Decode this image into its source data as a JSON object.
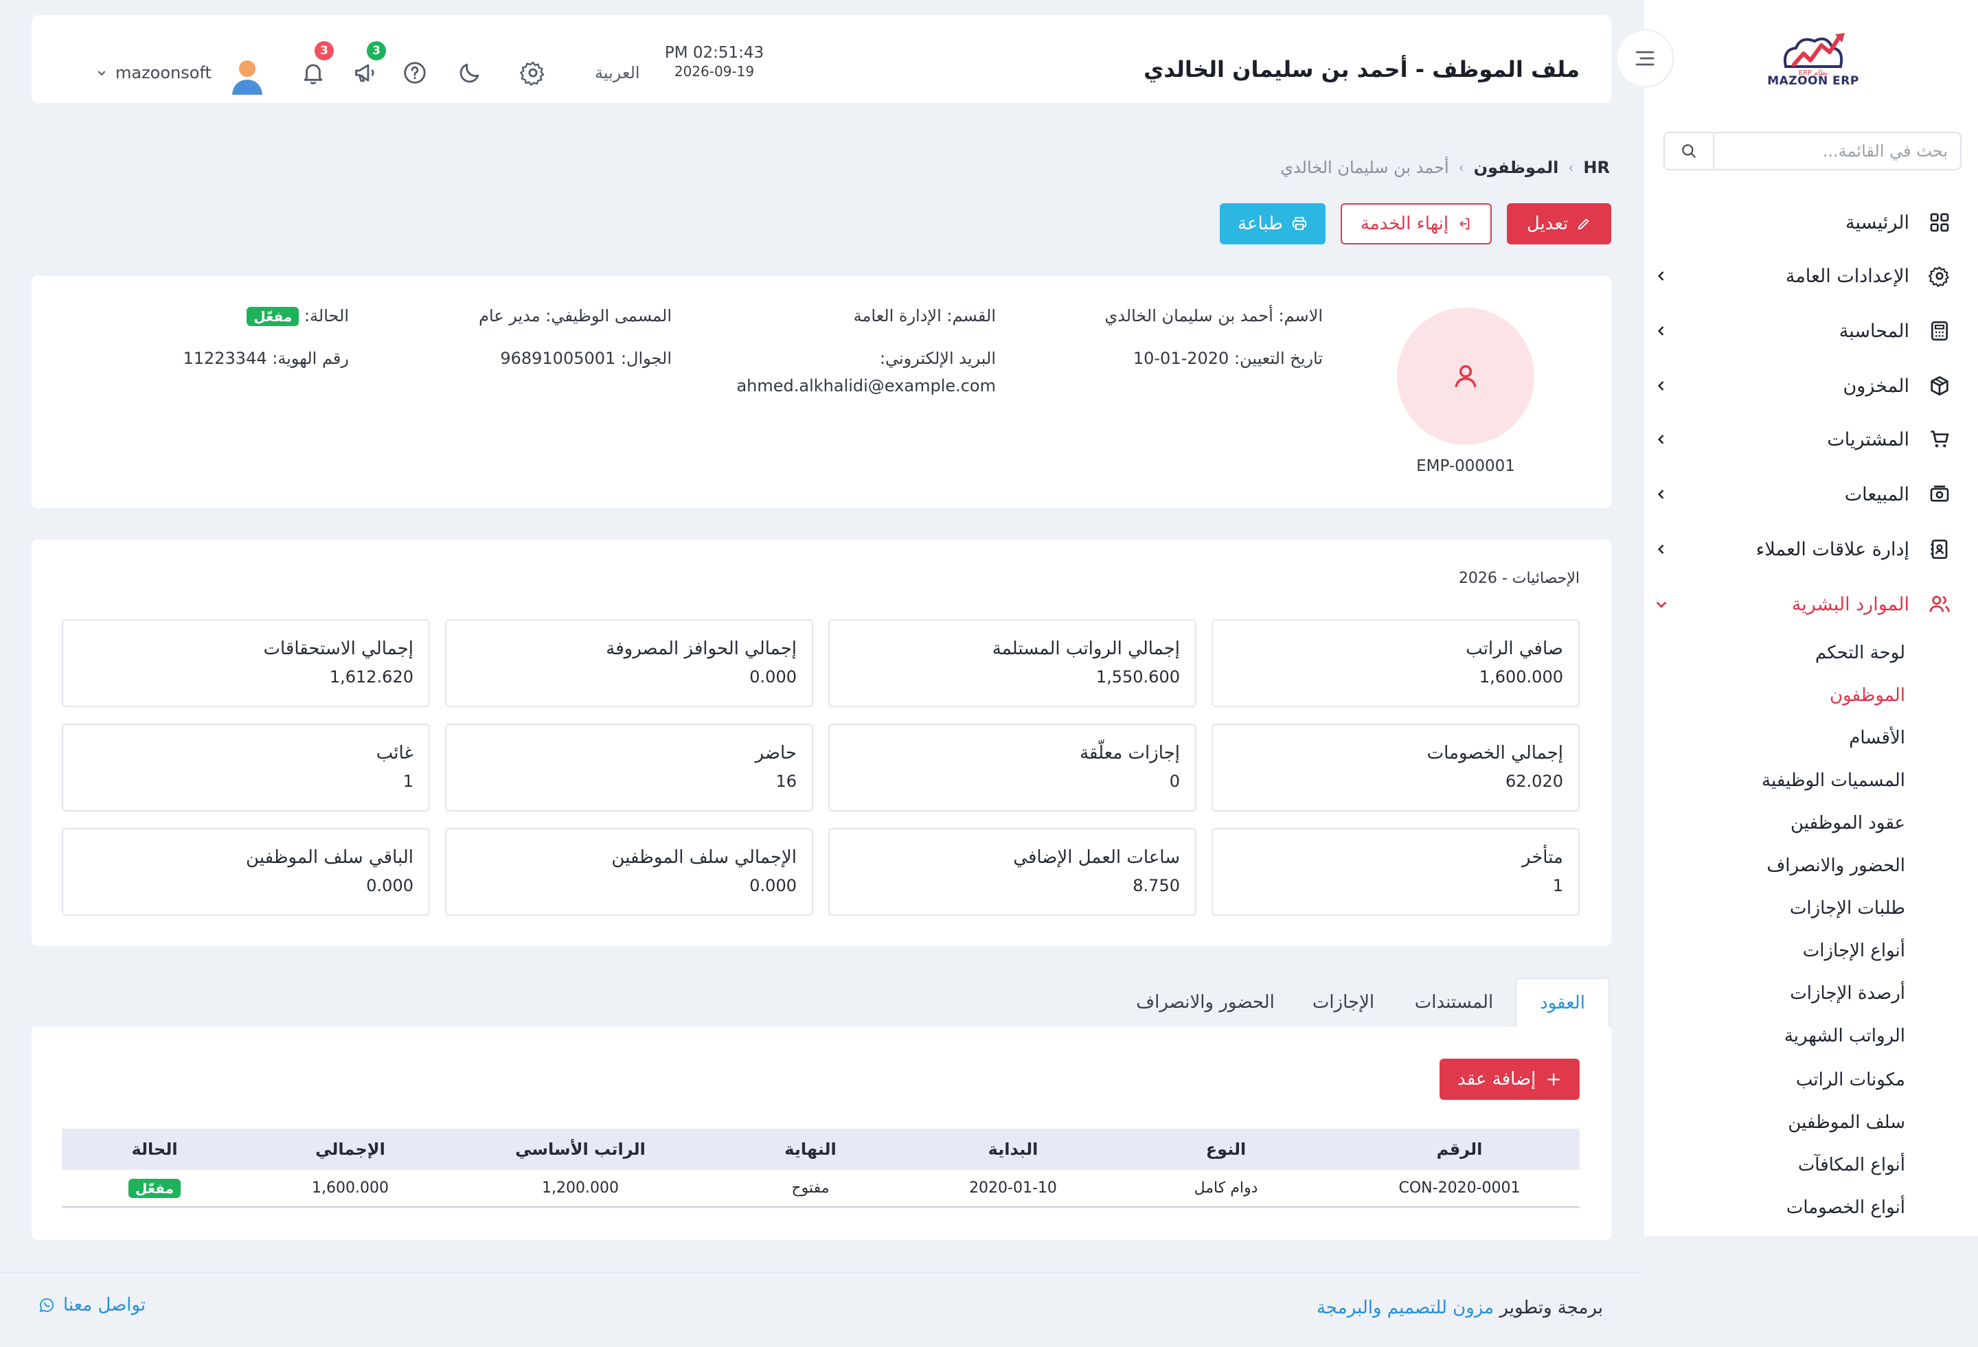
{
  "sidebar": {
    "logo": {
      "text": "MAZOON ERP",
      "small_text": "ERP نظام"
    },
    "search": {
      "placeholder": "بحث في القائمة...",
      "icon": "search-icon"
    },
    "items": [
      {
        "label": "الرئيسية",
        "icon": "grid-icon",
        "has_children": false
      },
      {
        "label": "الإعدادات العامة",
        "icon": "gear-icon",
        "has_children": true
      },
      {
        "label": "المحاسبة",
        "icon": "calculator-icon",
        "has_children": true
      },
      {
        "label": "المخزون",
        "icon": "box-icon",
        "has_children": true
      },
      {
        "label": "المشتريات",
        "icon": "cart-icon",
        "has_children": true
      },
      {
        "label": "المبيعات",
        "icon": "cash-icon",
        "has_children": true
      },
      {
        "label": "إدارة علاقات العملاء",
        "icon": "contacts-book-icon",
        "has_children": true
      },
      {
        "label": "الموارد البشرية",
        "icon": "users-icon",
        "has_children": true,
        "active": true,
        "expanded": true
      }
    ],
    "hr_subitems": [
      {
        "label": "لوحة التحكم"
      },
      {
        "label": "الموظفون",
        "active": true
      },
      {
        "label": "الأقسام"
      },
      {
        "label": "المسميات الوظيفية"
      },
      {
        "label": "عقود الموظفين"
      },
      {
        "label": "الحضور والانصراف"
      },
      {
        "label": "طلبات الإجازات"
      },
      {
        "label": "أنواع الإجازات"
      },
      {
        "label": "أرصدة الإجازات"
      },
      {
        "label": "الرواتب الشهرية"
      },
      {
        "label": "مكونات الراتب"
      },
      {
        "label": "سلف الموظفين"
      },
      {
        "label": "أنواع المكافآت"
      },
      {
        "label": "أنواع الخصومات"
      }
    ]
  },
  "header": {
    "title": "ملف الموظف - أحمد بن سليمان الخالدي",
    "time": "PM 02:51:43",
    "date": "2026-09-19",
    "language": "العربية",
    "notifications_count": "3",
    "announcements_count": "3",
    "username": "mazoonsoft"
  },
  "breadcrumb": {
    "root": "HR",
    "section": "الموظفون",
    "current": "أحمد بن سليمان الخالدي"
  },
  "actions": {
    "edit": "تعديل",
    "terminate": "إنهاء الخدمة",
    "print": "طباعة"
  },
  "profile": {
    "code": "EMP-000001",
    "name_label": "الاسم:",
    "name": "أحمد بن سليمان الخالدي",
    "hire_date_label": "تاريخ التعيين:",
    "hire_date": "10-01-2020",
    "department_label": "القسم:",
    "department": "الإدارة العامة",
    "email_label": "البريد الإلكتروني:",
    "email": "ahmed.alkhalidi@example.com",
    "job_title_label": "المسمى الوظيفي:",
    "job_title": "مدير عام",
    "mobile_label": "الجوال:",
    "mobile": "96891005001",
    "status_label": "الحالة:",
    "status": "مفعّل",
    "id_label": "رقم الهوية:",
    "id_number": "11223344"
  },
  "stats": {
    "title": "الإحصائيات - 2026",
    "items": [
      {
        "label": "صافي الراتب",
        "value": "1,600.000"
      },
      {
        "label": "إجمالي الرواتب المستلمة",
        "value": "1,550.600"
      },
      {
        "label": "إجمالي الحوافز المصروفة",
        "value": "0.000"
      },
      {
        "label": "إجمالي الاستحقاقات",
        "value": "1,612.620"
      },
      {
        "label": "إجمالي الخصومات",
        "value": "62.020"
      },
      {
        "label": "إجازات معلّقة",
        "value": "0"
      },
      {
        "label": "حاضر",
        "value": "16"
      },
      {
        "label": "غائب",
        "value": "1"
      },
      {
        "label": "متأخر",
        "value": "1"
      },
      {
        "label": "ساعات العمل الإضافي",
        "value": "8.750"
      },
      {
        "label": "الإجمالي سلف الموظفين",
        "value": "0.000"
      },
      {
        "label": "الباقي سلف الموظفين",
        "value": "0.000"
      }
    ]
  },
  "tabs": [
    {
      "label": "العقود",
      "active": true
    },
    {
      "label": "المستندات"
    },
    {
      "label": "الإجازات"
    },
    {
      "label": "الحضور والانصراف"
    }
  ],
  "contracts": {
    "add_label": "إضافة عقد",
    "columns": [
      "الرقم",
      "النوع",
      "البداية",
      "النهاية",
      "الراتب الأساسي",
      "الإجمالي",
      "الحالة"
    ],
    "rows": [
      [
        "CON-2020-0001",
        "دوام كامل",
        "2020-01-10",
        "مفتوح",
        "1,200.000",
        "1,600.000",
        "مفعّل"
      ]
    ]
  },
  "footer": {
    "credit_prefix": "برمجة وتطوير",
    "credit_link": "مزون للتصميم والبرمجة",
    "contact": "تواصل معنا"
  },
  "colors": {
    "primary_red": "#e0394c",
    "info_blue": "#2cb7e3",
    "link_blue": "#2690d8",
    "success_green": "#1eb25a",
    "badge_red": "#f0505f",
    "badge_green": "#1eb25a"
  }
}
